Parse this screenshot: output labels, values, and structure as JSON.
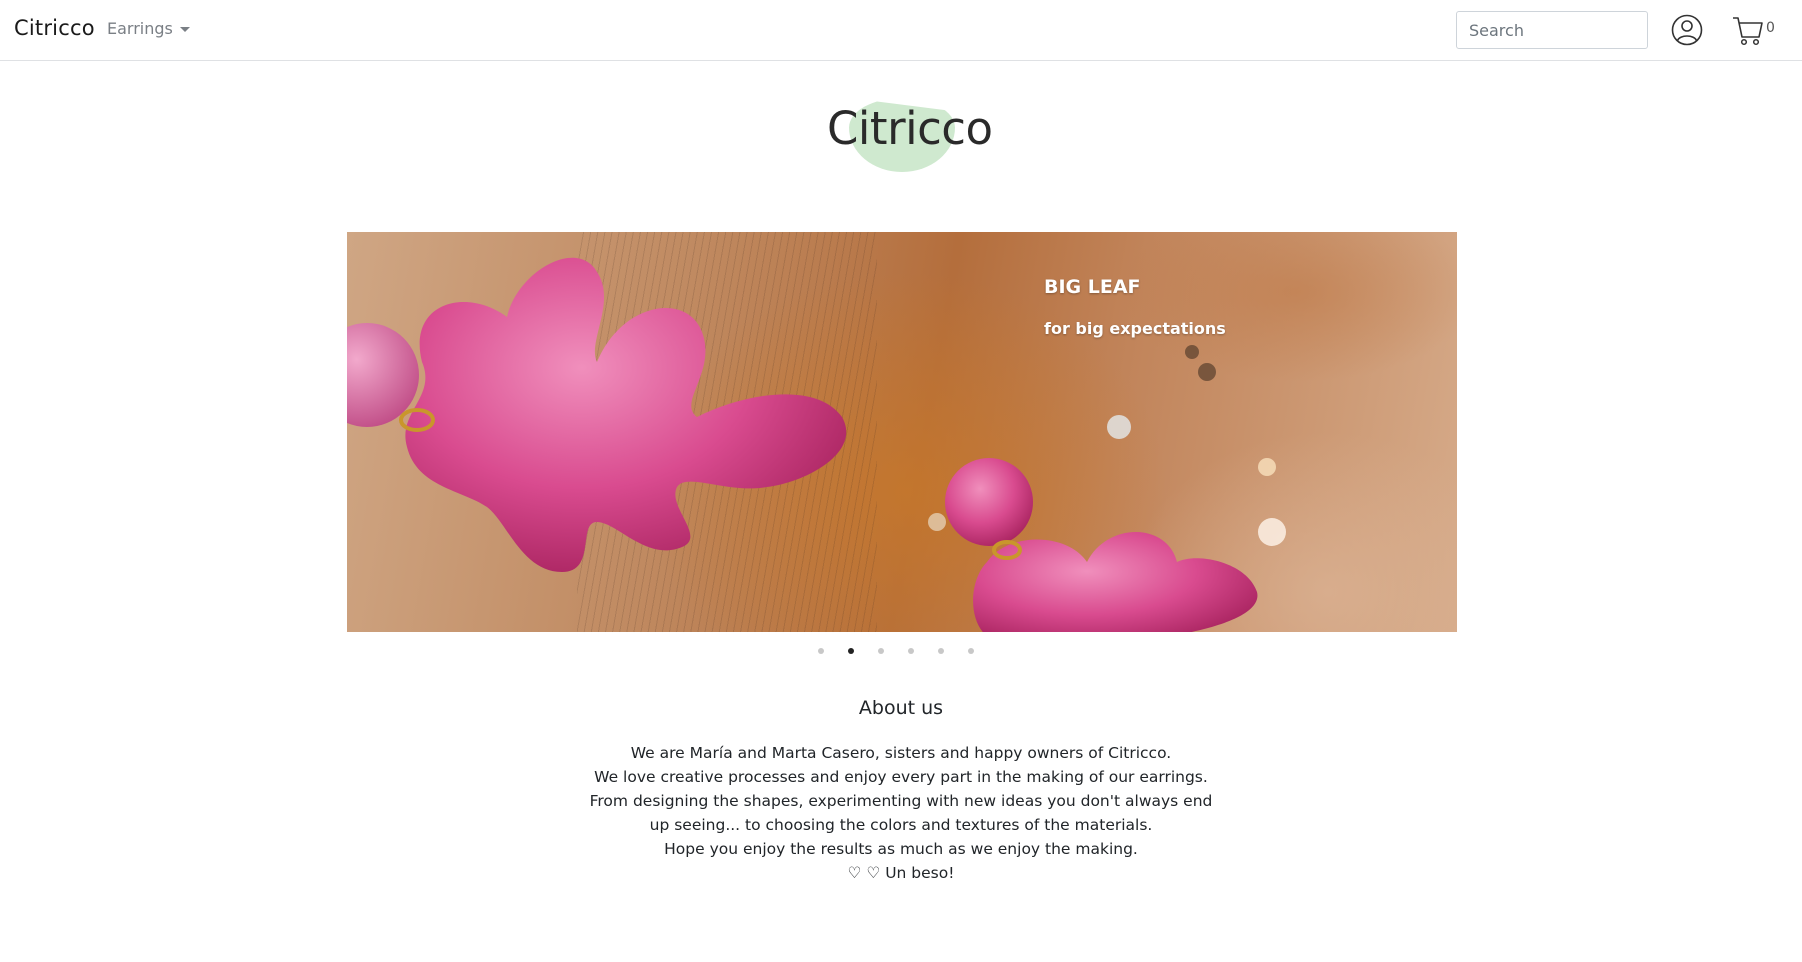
{
  "navbar": {
    "brand": "Citricco",
    "dropdown_label": "Earrings",
    "search_placeholder": "Search",
    "cart_count": "0"
  },
  "logo": {
    "text": "Citricco"
  },
  "carousel": {
    "caption_title": "BIG LEAF",
    "caption_subtitle": "for big expectations",
    "slide_count": 6,
    "active_index": 1
  },
  "about": {
    "title": "About us",
    "lines": [
      "We are María and Marta Casero, sisters and happy owners of Citricco.",
      "We love creative processes and enjoy every part in the making of our earrings.",
      "From designing the shapes, experimenting with new ideas you don't always end",
      "up seeing... to choosing the colors and textures of the materials.",
      "Hope you enjoy the results as much as we enjoy the making.",
      "♡ ♡ Un beso!"
    ]
  },
  "colors": {
    "logo_blob": "#cfe9cf",
    "earring_pink": "#d63f86",
    "indicator_active": "#222222"
  }
}
